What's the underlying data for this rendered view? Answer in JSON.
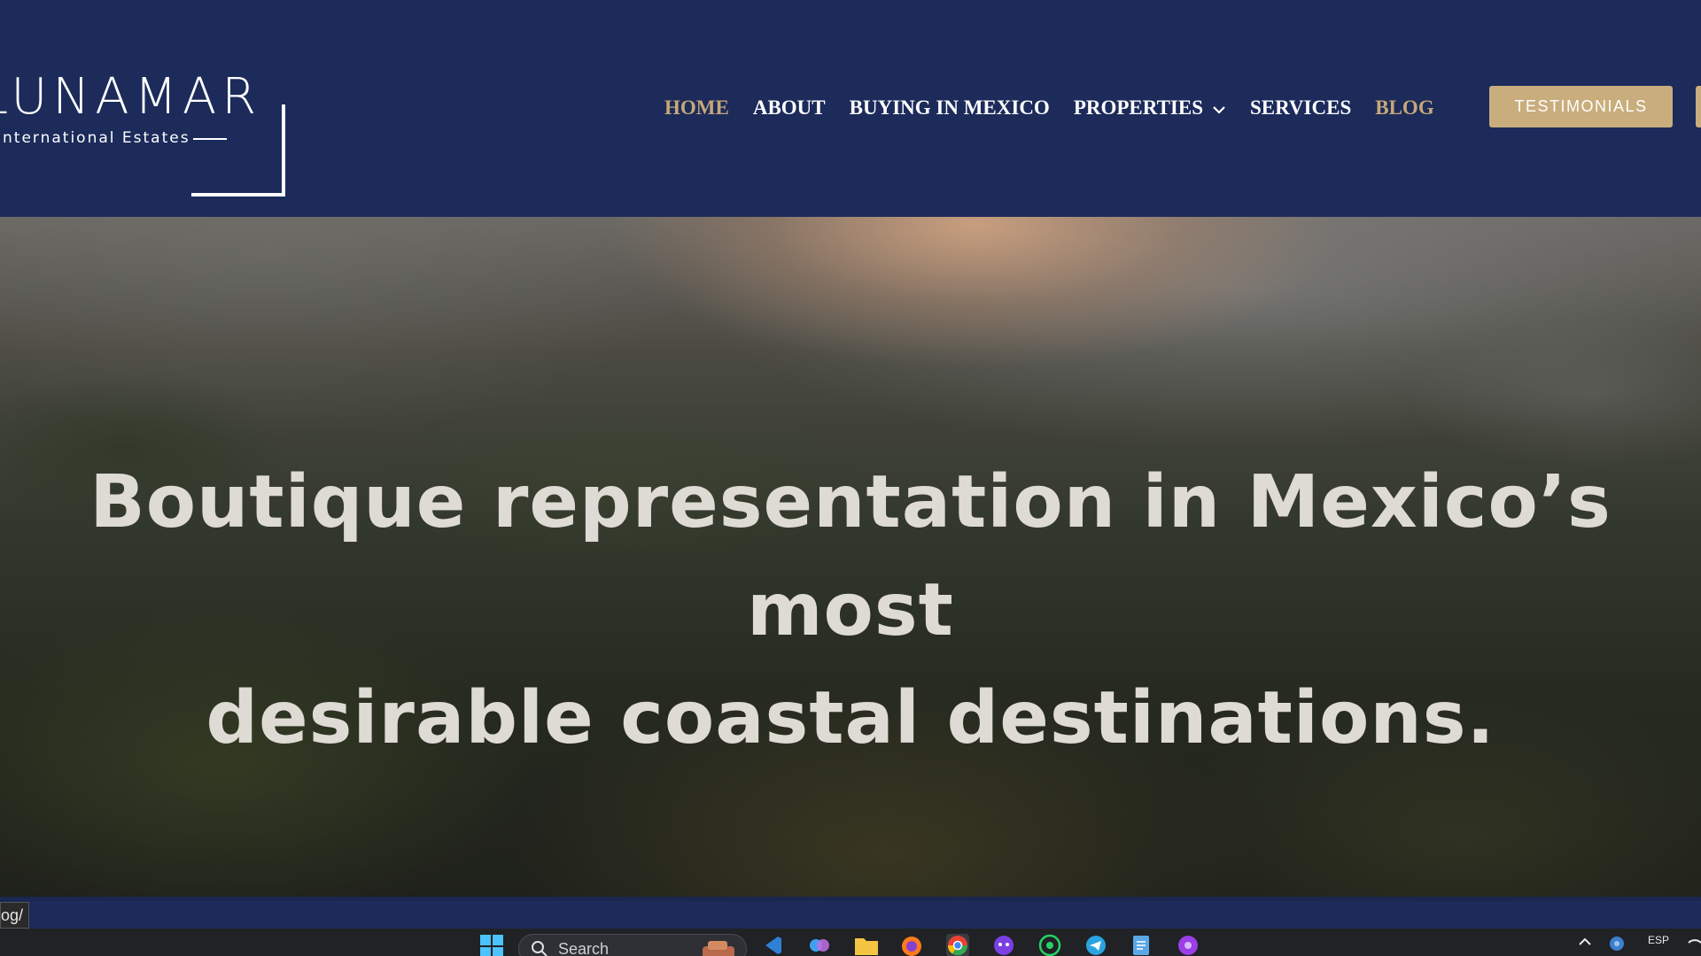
{
  "logo": {
    "wordmark": "LUNAMAR",
    "tagline": "International Estates"
  },
  "nav": {
    "items": [
      {
        "label": "HOME",
        "state": "active"
      },
      {
        "label": "ABOUT"
      },
      {
        "label": "BUYING IN MEXICO"
      },
      {
        "label": "PROPERTIES",
        "has_dropdown": true
      },
      {
        "label": "SERVICES"
      },
      {
        "label": "BLOG",
        "state": "hover"
      }
    ],
    "cta_label": "TESTIMONIALS"
  },
  "hero": {
    "headline_line1": "Boutique representation in Mexico’s most",
    "headline_line2": "desirable coastal destinations."
  },
  "status_url": "og/",
  "taskbar": {
    "search_placeholder": "Search",
    "tray_language": "ESP"
  },
  "colors": {
    "header_bg": "#1d2b5b",
    "accent_gold": "#c6a878",
    "cta_bg": "#c9ad7c",
    "hero_text": "#dedad4"
  }
}
